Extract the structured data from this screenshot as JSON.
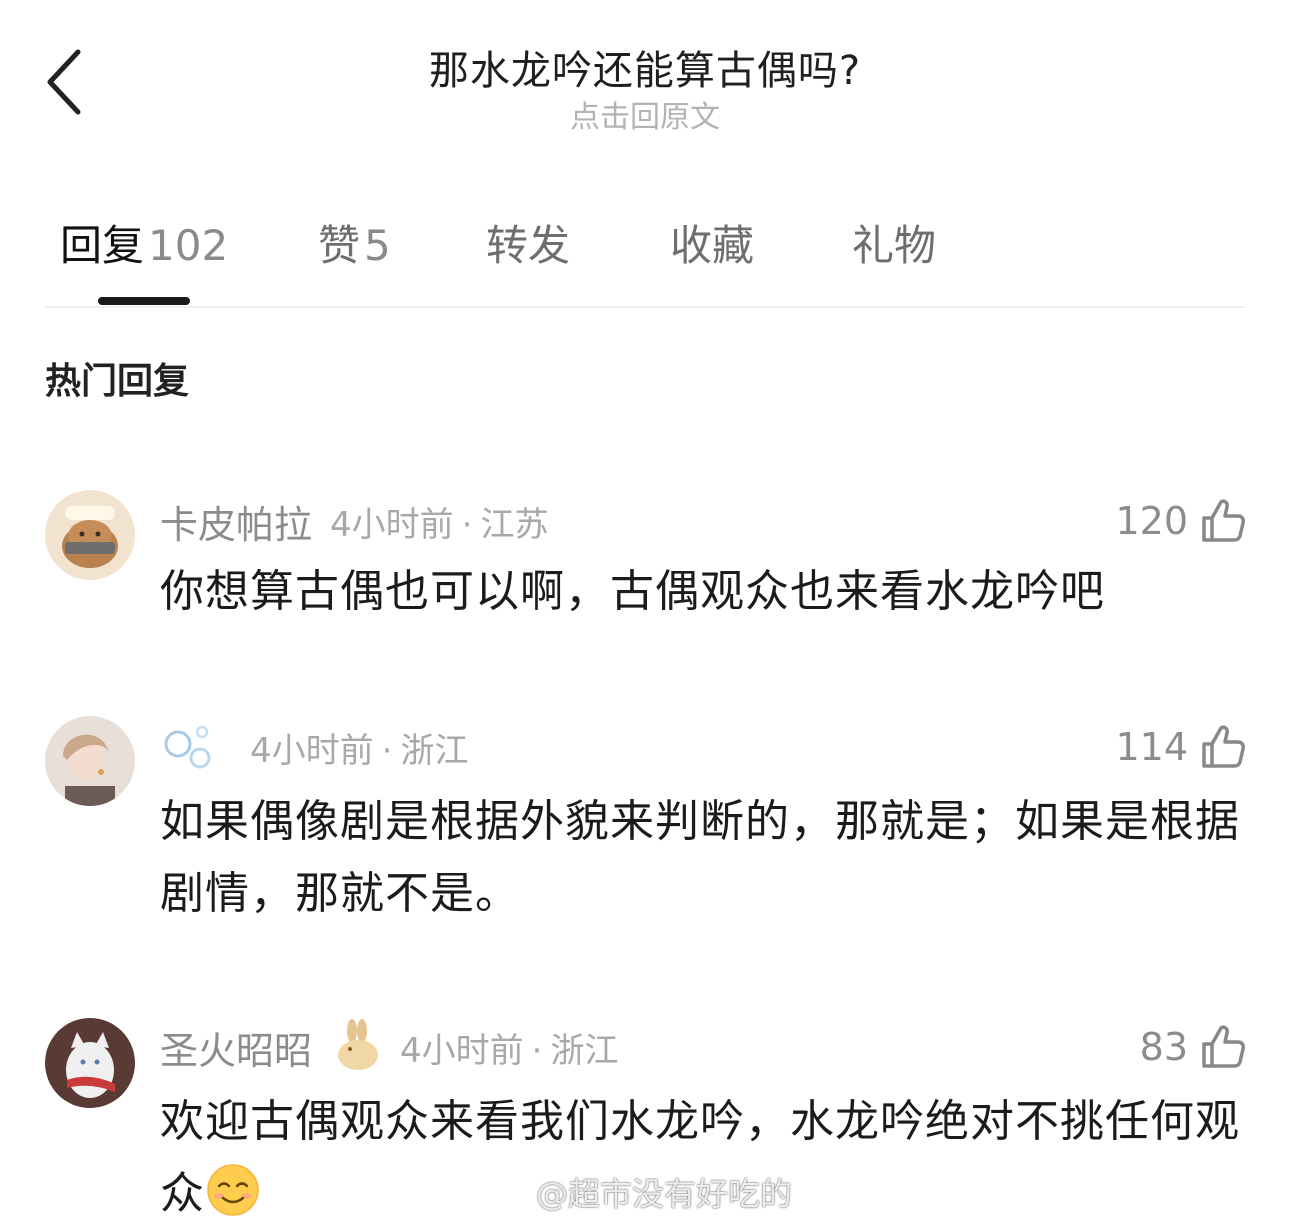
{
  "header": {
    "title": "那水龙吟还能算古偶吗?",
    "subtitle": "点击回原文"
  },
  "tabs": [
    {
      "label": "回复",
      "count": "102",
      "active": true
    },
    {
      "label": "赞",
      "count": "5"
    },
    {
      "label": "转发",
      "count": ""
    },
    {
      "label": "收藏",
      "count": ""
    },
    {
      "label": "礼物",
      "count": ""
    }
  ],
  "section_title": "热门回复",
  "comments": [
    {
      "username": "卡皮帕拉",
      "time": "4小时前",
      "location": "江苏",
      "likes": "120",
      "text": "你想算古偶也可以啊，古偶观众也来看水龙吟吧"
    },
    {
      "username": "",
      "time": "4小时前",
      "location": "浙江",
      "likes": "114",
      "text": "如果偶像剧是根据外貌来判断的，那就是；如果是根据剧情，那就不是。"
    },
    {
      "username": "圣火昭昭",
      "time": "4小时前",
      "location": "浙江",
      "likes": "83",
      "text": "欢迎古偶观众来看我们水龙吟，水龙吟绝对不挑任何观众"
    }
  ],
  "meta_separator": "·",
  "watermark": "@超市没有好吃的",
  "icons": {
    "back": "chevron-left-icon",
    "like": "thumbs-up-icon",
    "smile": "smiling-face-emoji",
    "weibo": "weibo-logo-icon"
  }
}
